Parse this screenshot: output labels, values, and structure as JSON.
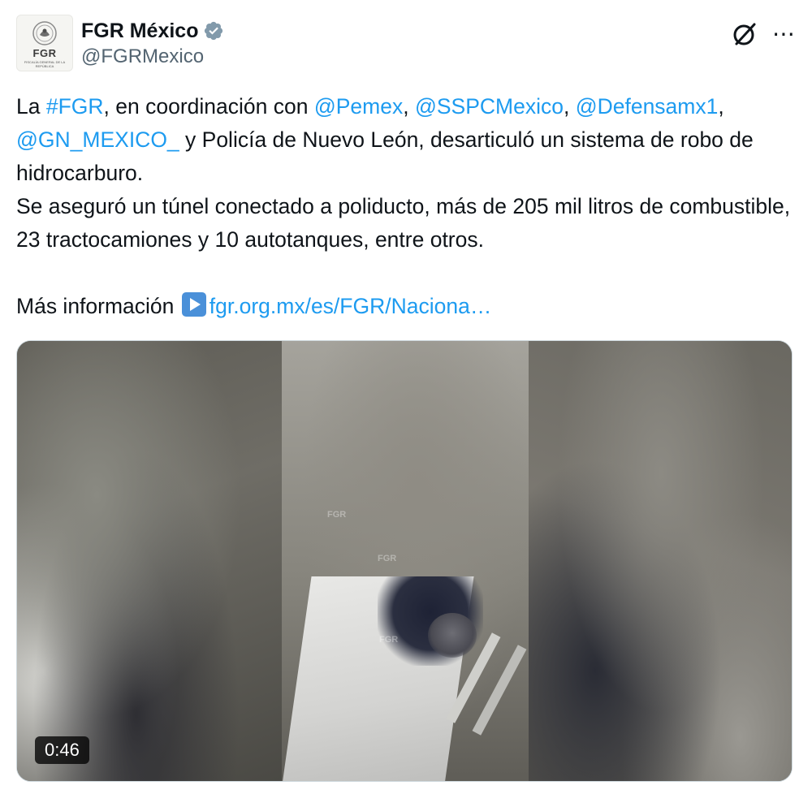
{
  "account": {
    "display_name": "FGR México",
    "handle": "@FGRMexico",
    "verified": true,
    "avatar_abbr": "FGR",
    "avatar_small_text": "FISCALÍA GENERAL DE LA REPÚBLICA"
  },
  "icons": {
    "grok": "grok-icon",
    "more": "more-icon",
    "verified": "verified-badge-icon",
    "link_emoji": "play-button-emoji-icon"
  },
  "tweet": {
    "p1_a": "La ",
    "p1_tag": "#FGR",
    "p1_b": ", en coordinación con ",
    "p1_m1": "@Pemex",
    "p1_c": ", ",
    "p1_m2": "@SSPCMexico",
    "p1_d": ", ",
    "p1_m3": "@Defensamx1",
    "p1_e": ", ",
    "p1_m4": "@GN_MEXICO_",
    "p1_f": " y Policía de Nuevo León, desarticuló un sistema de robo de hidrocarburo.",
    "p2": "Se aseguró un túnel conectado a poliducto, más de 205 mil litros de combustible, 23 tractocamiones y 10 autotanques, entre otros.",
    "p3_label": "Más información ",
    "p3_link": "fgr.org.mx/es/FGR/Naciona…"
  },
  "media": {
    "duration": "0:46",
    "watermark": "FGR"
  },
  "colors": {
    "link": "#1d9bf0",
    "text": "#0f1419",
    "secondary": "#536471",
    "verified_badge": "#829aab"
  }
}
